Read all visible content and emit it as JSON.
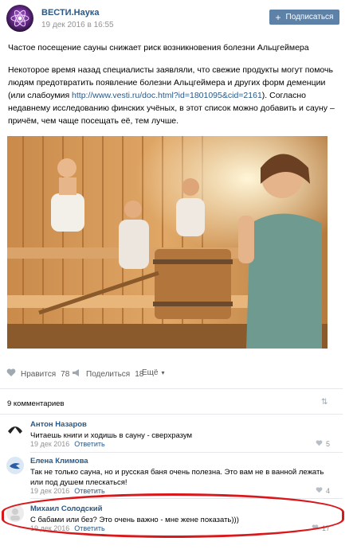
{
  "post": {
    "author": "ВЕСТИ.Наука",
    "date": "19 дек 2016 в 16:55",
    "subscribe_label": "Подписаться",
    "headline": "Частое посещение сауны снижает риск возникновения болезни Альцгеймера",
    "body_before_link": "Некоторое время назад специалисты заявляли, что свежие продукты могут помочь людям предотвратить появление болезни Альцгеймера и других форм деменции (или слабоумия ",
    "link": "http://www.vesti.ru/doc.html?id=1801095&cid=2161",
    "body_after_link": "). Согласно недавнему исследованию финских учёных, в этот список можно добавить и сауну – причём, чем чаще посещать её, тем лучше."
  },
  "actions": {
    "like_label": "Нравится",
    "like_count": "78",
    "share_label": "Поделиться",
    "share_count": "18",
    "more_label": "Ещё"
  },
  "comments_header": "9 комментариев",
  "comments": [
    {
      "name": "Антон Назаров",
      "text": "Читаешь книги и ходишь в сауну - сверхразум",
      "date": "19 дек 2016",
      "reply": "Ответить",
      "likes": "5"
    },
    {
      "name": "Елена Климова",
      "text": "Так не только сауна, но и русская баня очень полезна. Это вам не в ванной лежать или под душем плескаться!",
      "date": "19 дек 2016",
      "reply": "Ответить",
      "likes": "4"
    },
    {
      "name": "Михаил Солодский",
      "text": "С бабами или без? Это очень важно - мне жене показать)))",
      "date": "19 дек 2016",
      "reply": "Ответить",
      "likes": "17"
    }
  ],
  "colors": {
    "link": "#2a5885",
    "button": "#5e81a8",
    "highlight": "#d8181b"
  }
}
